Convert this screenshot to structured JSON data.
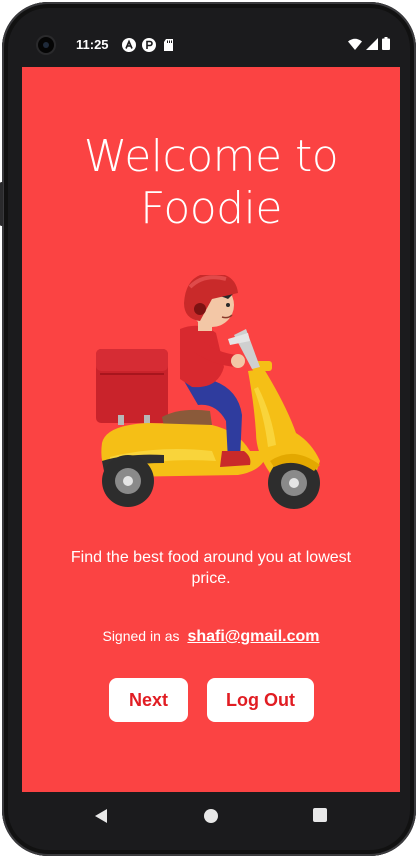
{
  "status_bar": {
    "time": "11:25",
    "icons": [
      "circle-a-icon",
      "circle-p-icon",
      "sd-card-icon",
      "wifi-icon",
      "signal-icon",
      "battery-icon"
    ]
  },
  "welcome": {
    "title": "Welcome to\nFoodie",
    "hero_image": "delivery-scooter-illustration",
    "tagline": "Find the best food around you at lowest price."
  },
  "session": {
    "signed_in_label": "Signed in as",
    "email": "shafi@gmail.com"
  },
  "actions": {
    "next_label": "Next",
    "logout_label": "Log Out"
  },
  "nav_bar": {
    "icons": [
      "back-triangle-icon",
      "home-circle-icon",
      "recents-square-icon"
    ]
  },
  "colors": {
    "screen_background": "#fb4343",
    "button_text": "#e11d23",
    "button_background": "#ffffff",
    "device_frame": "#1b1b1d"
  }
}
